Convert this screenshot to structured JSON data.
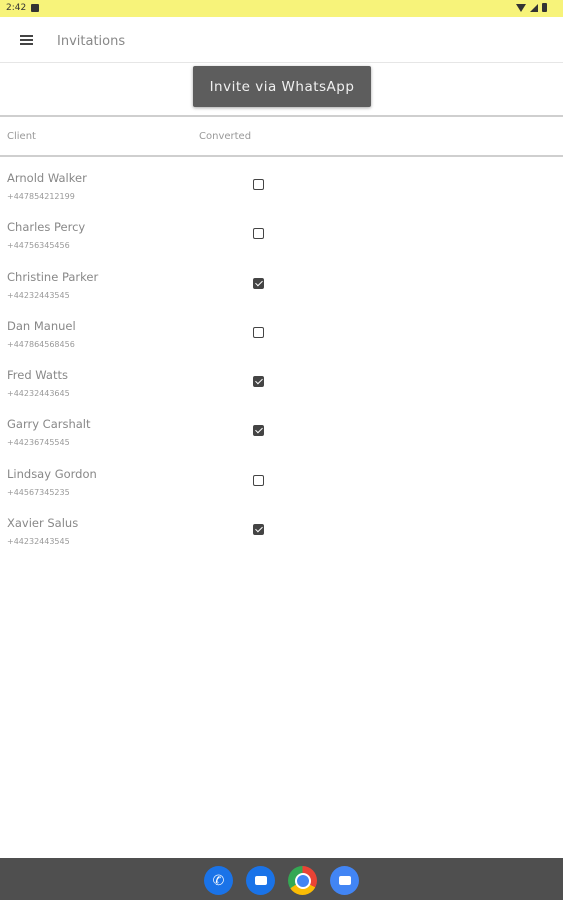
{
  "status_bar": {
    "time": "2:42"
  },
  "app_bar": {
    "title": "Invitations"
  },
  "invite_button_label": "Invite via WhatsApp",
  "table_header": {
    "client": "Client",
    "converted": "Converted"
  },
  "clients": [
    {
      "name": "Arnold Walker",
      "phone": "+447854212199",
      "converted": false
    },
    {
      "name": "Charles Percy",
      "phone": "+44756345456",
      "converted": false
    },
    {
      "name": "Christine Parker",
      "phone": "+44232443545",
      "converted": true
    },
    {
      "name": "Dan Manuel",
      "phone": "+447864568456",
      "converted": false
    },
    {
      "name": "Fred Watts",
      "phone": "+44232443645",
      "converted": true
    },
    {
      "name": "Garry Carshalt",
      "phone": "+44236745545",
      "converted": true
    },
    {
      "name": "Lindsay Gordon",
      "phone": "+44567345235",
      "converted": false
    },
    {
      "name": "Xavier Salus",
      "phone": "+44232443545",
      "converted": true
    }
  ],
  "dock_apps": [
    "phone-icon",
    "messages-icon",
    "chrome-icon",
    "camera-icon"
  ],
  "colors": {
    "status_bar": "#f7f37a",
    "button": "#5d5d5d",
    "nav_bar": "#4f4f4f"
  }
}
